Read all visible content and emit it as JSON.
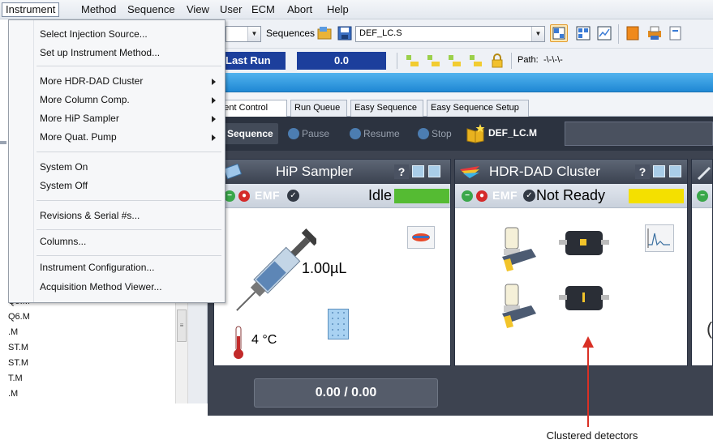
{
  "menubar": {
    "items": [
      "Instrument",
      "Method",
      "Sequence",
      "View",
      "User",
      "ECM",
      "Abort",
      "Help"
    ]
  },
  "dropdown": {
    "items": [
      {
        "label": "Select Injection Source...",
        "submenu": false
      },
      {
        "label": "Set up Instrument Method...",
        "submenu": false
      },
      {
        "label": "More HDR-DAD Cluster",
        "submenu": true
      },
      {
        "label": "More Column Comp.",
        "submenu": true
      },
      {
        "label": "More HiP Sampler",
        "submenu": true
      },
      {
        "label": "More Quat. Pump",
        "submenu": true
      },
      {
        "label": "System On",
        "submenu": false
      },
      {
        "label": "System Off",
        "submenu": false
      },
      {
        "label": "Revisions & Serial #s...",
        "submenu": false
      },
      {
        "label": "Columns...",
        "submenu": false
      },
      {
        "label": "Instrument Configuration...",
        "submenu": false
      },
      {
        "label": "Acquisition Method Viewer...",
        "submenu": false
      }
    ]
  },
  "toolbar": {
    "sequences_label": "Sequences",
    "sequence_file": "DEF_LC.S",
    "last_run_label": "Last Run",
    "last_run_value": "0.0",
    "path_label": "Path:",
    "path_value": "-\\-\\-\\-"
  },
  "tabs": [
    "ument Control",
    "Run Queue",
    "Easy Sequence",
    "Easy Sequence Setup"
  ],
  "seqbar": {
    "sequence": "Sequence",
    "pause": "Pause",
    "resume": "Resume",
    "stop": "Stop",
    "method": "DEF_LC.M"
  },
  "modules": {
    "sampler": {
      "title": "HiP Sampler",
      "emf": "EMF",
      "status": "Idle",
      "status_color": "#55bb33",
      "volume": "1.00µL",
      "temperature": "4 °C"
    },
    "dad": {
      "title": "HDR-DAD Cluster",
      "emf": "EMF",
      "status": "Not Ready",
      "status_color": "#f4e000"
    }
  },
  "progress": "0.00 / 0.00",
  "left_files": [
    "Q5.M",
    "Q6.M",
    ".M",
    "ST.M",
    "ST.M",
    "T.M",
    ".M"
  ],
  "annotation": "Clustered detectors",
  "colors": {
    "accent_blue": "#1f88d4",
    "annotation_red": "#d93025"
  }
}
